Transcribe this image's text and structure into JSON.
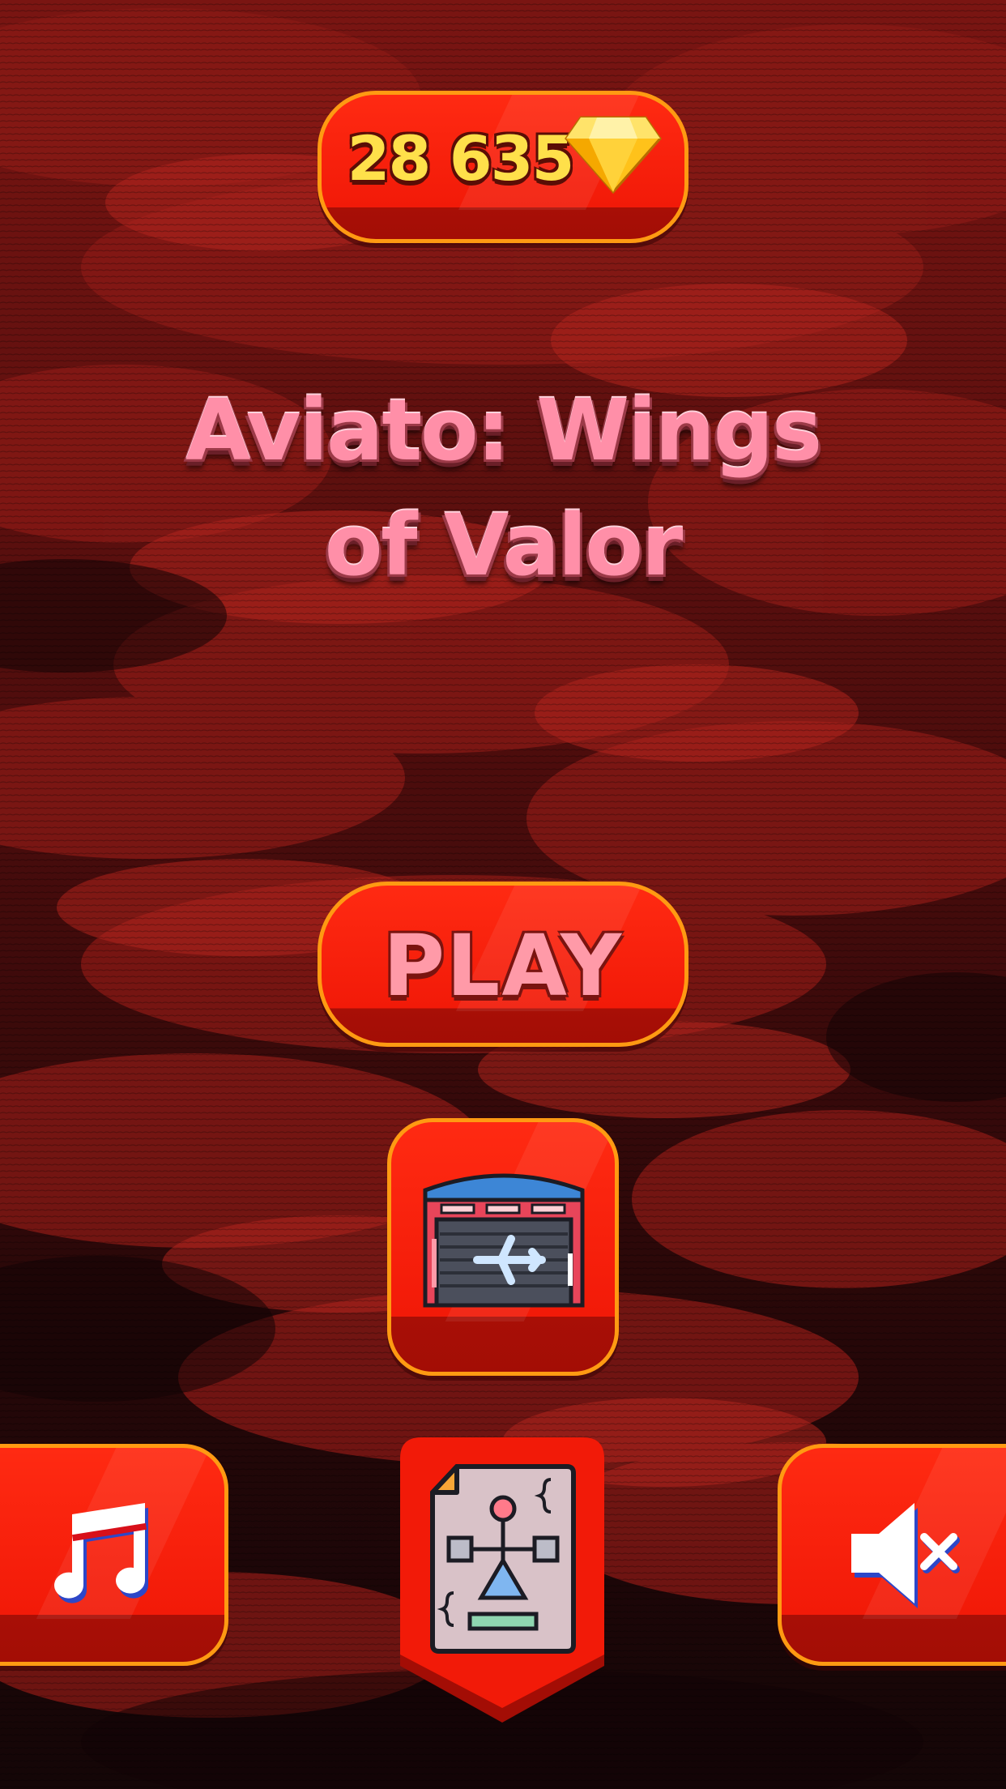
{
  "currency": {
    "amount": "28 635",
    "icon": "gem-icon",
    "color": "#ffe04a"
  },
  "title": {
    "line1": "Aviato: Wings",
    "line2": "of Valor"
  },
  "play": {
    "label": "PLAY"
  },
  "buttons": {
    "hangar": {
      "icon": "hangar-airplane-icon"
    },
    "music": {
      "icon": "music-note-icon"
    },
    "blueprint": {
      "icon": "blueprint-document-icon"
    },
    "sound": {
      "icon": "speaker-muted-icon"
    }
  },
  "colors": {
    "button_face": "#f21a08",
    "button_border": "#ff9a12",
    "title_pink": "#ff8fa8",
    "background": "#3a0a0a"
  }
}
